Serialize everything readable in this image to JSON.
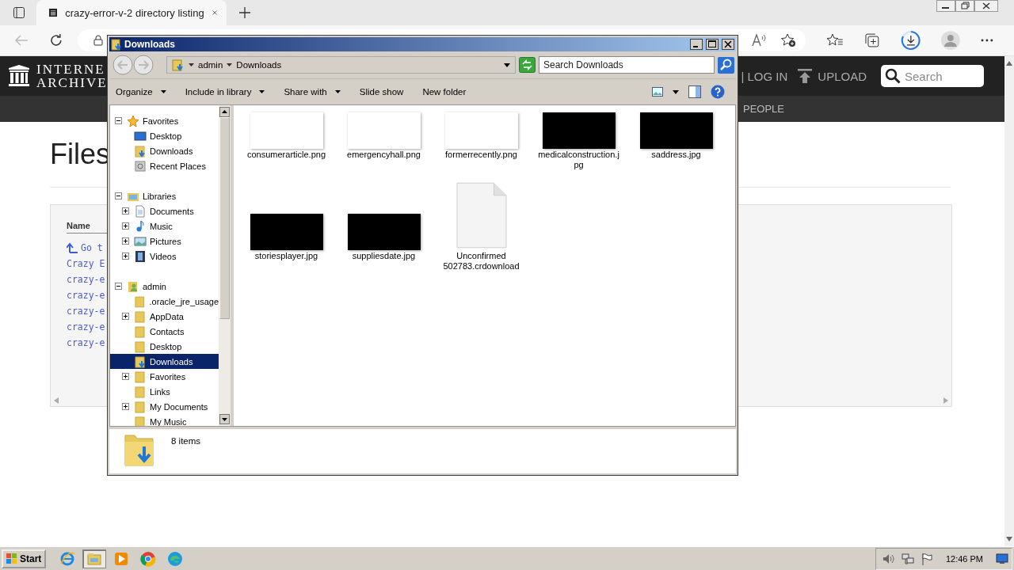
{
  "browser": {
    "tabs": [
      {
        "title": "crazy-error-v-2 directory listing",
        "selected": true
      }
    ]
  },
  "site": {
    "logo": [
      "INTERNE",
      "ARCHIVE"
    ],
    "login": "| LOG IN",
    "upload": "UPLOAD",
    "search": {
      "placeholder": "Search"
    },
    "nav": [
      "PEOPLE"
    ],
    "heading": "Files",
    "table": {
      "column": "Name",
      "rows": [
        {
          "text": "Go t",
          "kind": "parent"
        },
        {
          "text": "Crazy E",
          "kind": "link"
        },
        {
          "text": "crazy-e",
          "kind": "link"
        },
        {
          "text": "crazy-e",
          "kind": "link"
        },
        {
          "text": "crazy-e",
          "kind": "link"
        },
        {
          "text": "crazy-e",
          "kind": "link"
        },
        {
          "text": "crazy-e",
          "kind": "link"
        }
      ]
    }
  },
  "explorer": {
    "title": "Downloads",
    "breadcrumb": [
      "admin",
      "Downloads"
    ],
    "search": {
      "placeholder": "Search Downloads"
    },
    "toolbar": [
      {
        "label": "Organize",
        "dropdown": true
      },
      {
        "label": "Include in library",
        "dropdown": true
      },
      {
        "label": "Share with",
        "dropdown": true
      },
      {
        "label": "Slide show",
        "dropdown": false
      },
      {
        "label": "New folder",
        "dropdown": false
      }
    ],
    "nav": [
      {
        "label": "Favorites",
        "kind": "star",
        "expanded": true,
        "selected": false,
        "children": [
          {
            "label": "Desktop",
            "kind": "desktop",
            "selected": false
          },
          {
            "label": "Downloads",
            "kind": "download",
            "selected": false
          },
          {
            "label": "Recent Places",
            "kind": "recent",
            "selected": false
          }
        ]
      },
      {
        "label": "Libraries",
        "kind": "library",
        "expanded": true,
        "selected": false,
        "children": [
          {
            "label": "Documents",
            "kind": "document",
            "expanded": false,
            "selected": false
          },
          {
            "label": "Music",
            "kind": "music",
            "expanded": false,
            "selected": false
          },
          {
            "label": "Pictures",
            "kind": "pictures",
            "expanded": false,
            "selected": false
          },
          {
            "label": "Videos",
            "kind": "videos",
            "expanded": false,
            "selected": false
          }
        ]
      },
      {
        "label": "admin",
        "kind": "user",
        "expanded": true,
        "selected": false,
        "children": [
          {
            "label": ".oracle_jre_usage",
            "kind": "folder",
            "selected": false
          },
          {
            "label": "AppData",
            "kind": "folder",
            "expanded": false,
            "selected": false
          },
          {
            "label": "Contacts",
            "kind": "folder",
            "selected": false
          },
          {
            "label": "Desktop",
            "kind": "folder",
            "selected": false
          },
          {
            "label": "Downloads",
            "kind": "download",
            "selected": true
          },
          {
            "label": "Favorites",
            "kind": "folder",
            "expanded": false,
            "selected": false
          },
          {
            "label": "Links",
            "kind": "folder",
            "selected": false
          },
          {
            "label": "My Documents",
            "kind": "folder",
            "expanded": false,
            "selected": false
          },
          {
            "label": "My Music",
            "kind": "folder",
            "selected": false
          }
        ]
      }
    ],
    "files": [
      {
        "name": "consumerarticle.png",
        "kind": "light"
      },
      {
        "name": "emergencyhall.png",
        "kind": "light"
      },
      {
        "name": "formerrecently.png",
        "kind": "light"
      },
      {
        "name": "medicalconstruction.jpg",
        "kind": "dark"
      },
      {
        "name": "saddress.jpg",
        "kind": "dark"
      },
      {
        "name": "storiesplayer.jpg",
        "kind": "dark"
      },
      {
        "name": "suppliesdate.jpg",
        "kind": "dark"
      },
      {
        "name": "Unconfirmed 502783.crdownload",
        "kind": "document"
      }
    ],
    "status": "8 items"
  },
  "taskbar": {
    "start": "Start",
    "apps": [
      {
        "kind": "ie",
        "selected": false
      },
      {
        "kind": "explorer",
        "selected": true
      },
      {
        "kind": "media",
        "selected": false
      },
      {
        "kind": "chrome",
        "selected": false
      },
      {
        "kind": "edge",
        "selected": false
      }
    ],
    "clock": "12:46 PM"
  }
}
